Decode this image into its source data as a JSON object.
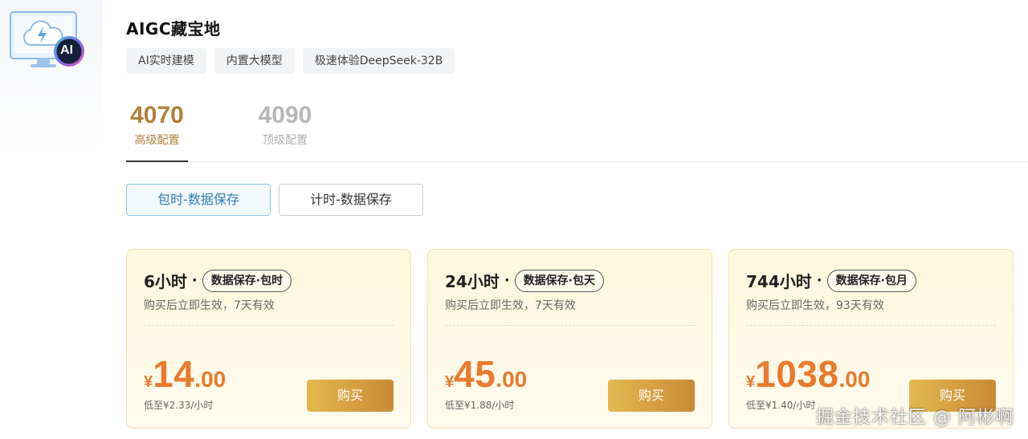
{
  "app": {
    "title": "AIGC藏宝地",
    "icon": "monitor-cloud-ai-icon",
    "badge_text": "AI"
  },
  "tags": [
    "AI实时建模",
    "内置大模型",
    "极速体验DeepSeek-32B"
  ],
  "config_tabs": [
    {
      "number": "4070",
      "label": "高级配置",
      "active": true
    },
    {
      "number": "4090",
      "label": "顶级配置",
      "active": false
    }
  ],
  "mode_buttons": [
    {
      "label": "包时-数据保存",
      "active": true
    },
    {
      "label": "计时-数据保存",
      "active": false
    }
  ],
  "plans": [
    {
      "duration": "6小时",
      "badge": "数据保存·包时",
      "validity": "购买后立即生效，7天有效",
      "currency": "¥",
      "price_int": "14",
      "price_dec": ".00",
      "per_hour": "低至¥2.33/小时",
      "buy_label": "购买"
    },
    {
      "duration": "24小时",
      "badge": "数据保存·包天",
      "validity": "购买后立即生效，7天有效",
      "currency": "¥",
      "price_int": "45",
      "price_dec": ".00",
      "per_hour": "低至¥1.88/小时",
      "buy_label": "购买"
    },
    {
      "duration": "744小时",
      "badge": "数据保存·包月",
      "validity": "购买后立即生效，93天有效",
      "currency": "¥",
      "price_int": "1038",
      "price_dec": ".00",
      "per_hour": "低至¥1.40/小时",
      "buy_label": "购买"
    }
  ],
  "separator_dot": "·",
  "watermark": "掘金技术社区 @ 阿彬啊",
  "colors": {
    "accent_gold": "#b0803a",
    "price_orange": "#ea7a2d",
    "active_blue": "#2f7fb0",
    "card_bg": "#fff7dc"
  }
}
